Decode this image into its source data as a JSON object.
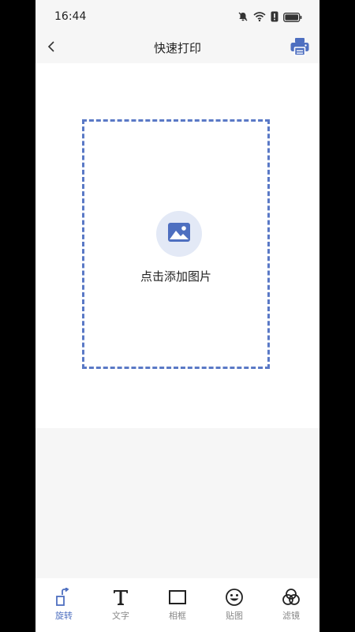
{
  "status_bar": {
    "time": "16:44",
    "icons": [
      "bell-muted-icon",
      "wifi-icon",
      "alert-icon",
      "battery-icon"
    ]
  },
  "header": {
    "title": "快速打印",
    "back_icon": "chevron-left-icon",
    "print_icon": "printer-icon"
  },
  "canvas": {
    "add_image_label": "点击添加图片",
    "add_image_icon": "image-icon"
  },
  "toolbar": {
    "items": [
      {
        "label": "旋转",
        "icon": "rotate-icon",
        "active": true
      },
      {
        "label": "文字",
        "icon": "text-icon",
        "active": false
      },
      {
        "label": "相框",
        "icon": "frame-icon",
        "active": false
      },
      {
        "label": "贴图",
        "icon": "sticker-icon",
        "active": false
      },
      {
        "label": "滤镜",
        "icon": "filter-icon",
        "active": false
      }
    ]
  },
  "colors": {
    "accent": "#4e6fc0",
    "dashed_border": "#5a79c6",
    "icon_bg": "#e3e9f6",
    "panel_bg": "#f6f6f6",
    "inactive_text": "#888888"
  }
}
